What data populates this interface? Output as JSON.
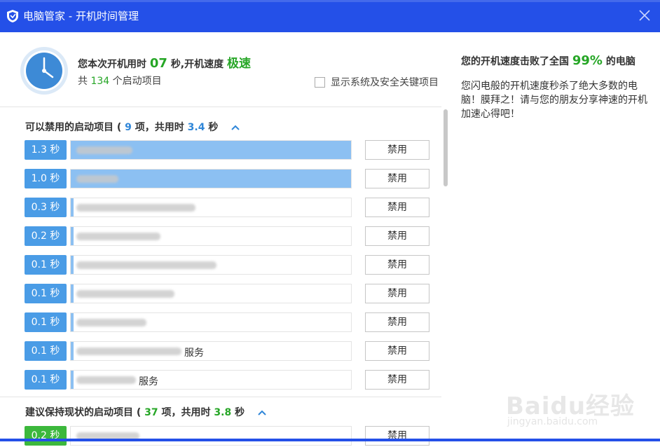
{
  "window": {
    "title": "电脑管家 - 开机时间管理",
    "accent_color": "#2450e8",
    "close_icon": "close-icon",
    "app_icon": "shield-icon"
  },
  "summary": {
    "boot_prefix": "您本次开机用时",
    "boot_seconds": "07",
    "boot_mid": "秒,开机速度",
    "boot_speed": "极速",
    "startup_prefix": "共",
    "startup_count": "134",
    "startup_suffix": "个启动项目",
    "show_system_label": "显示系统及安全关键项目",
    "show_system_checked": false,
    "clock_icon": "clock-icon"
  },
  "right_panel": {
    "beat_prefix": "您的开机速度击败了全国",
    "beat_percent": "99%",
    "beat_suffix": "的电脑",
    "share_text": "您闪电般的开机速度秒杀了绝大多数的电脑！膜拜之！请与您的朋友分享神速的开机加速心得吧！"
  },
  "disable_section": {
    "prefix": "可以禁用的启动项目 (",
    "count": "9",
    "mid": "项，共用时",
    "time": "3.4",
    "suffix": "秒",
    "chevron_icon": "chevron-up-icon",
    "items": [
      {
        "time": "1.3 秒",
        "suffix": "",
        "button": "禁用",
        "fill": 1.0
      },
      {
        "time": "1.0 秒",
        "suffix": "",
        "button": "禁用",
        "fill": 1.0
      },
      {
        "time": "0.3 秒",
        "suffix": "",
        "button": "禁用",
        "fill": 0.01
      },
      {
        "time": "0.2 秒",
        "suffix": "",
        "button": "禁用",
        "fill": 0.01
      },
      {
        "time": "0.1 秒",
        "suffix": "",
        "button": "禁用",
        "fill": 0.005
      },
      {
        "time": "0.1 秒",
        "suffix": "",
        "button": "禁用",
        "fill": 0.005
      },
      {
        "time": "0.1 秒",
        "suffix": "",
        "button": "禁用",
        "fill": 0.005
      },
      {
        "time": "0.1 秒",
        "suffix": "服务",
        "button": "禁用",
        "fill": 0.005
      },
      {
        "time": "0.1 秒",
        "suffix": "服务",
        "button": "禁用",
        "fill": 0.005
      }
    ]
  },
  "keep_section": {
    "prefix": "建议保持现状的启动项目 (",
    "count": "37",
    "mid": "项，共用时",
    "time": "3.8",
    "suffix": "秒",
    "chevron_icon": "chevron-up-icon",
    "items": [
      {
        "time": "0.2 秒",
        "button": "禁用"
      }
    ]
  },
  "watermark": {
    "brand": "Baidu经验",
    "url": "jingyan.baidu.com"
  }
}
